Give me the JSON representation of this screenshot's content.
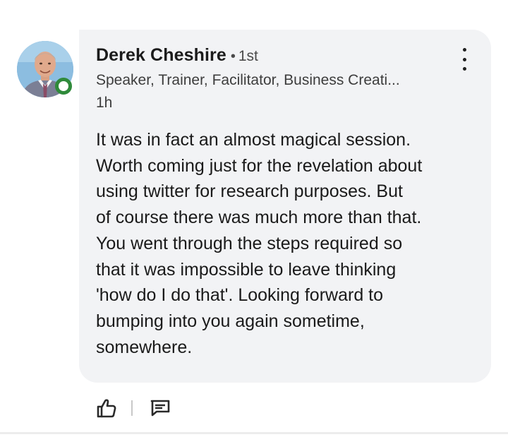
{
  "comment": {
    "author": {
      "name": "Derek Cheshire",
      "connection_separator": "•",
      "connection_degree": "1st",
      "headline": "Speaker, Trainer, Facilitator, Business Creati...",
      "online": true
    },
    "timestamp": "1h",
    "body_lines": [
      "It was in fact an almost magical session.",
      "Worth coming just for the revelation about",
      "using twitter for research purposes. But",
      "of course there was much more than that.",
      "You went through the steps required so",
      "that it was impossible to leave thinking",
      "'how do I do that'. Looking forward to",
      "bumping into you again sometime,",
      "somewhere."
    ]
  },
  "actions": {
    "like_icon": "thumbs-up-icon",
    "reply_icon": "comment-icon"
  },
  "colors": {
    "bubble_background": "#f2f3f5",
    "online_indicator": "#2f8a3a",
    "text_primary": "#1a1a1a",
    "text_secondary": "#3d3d3d"
  }
}
